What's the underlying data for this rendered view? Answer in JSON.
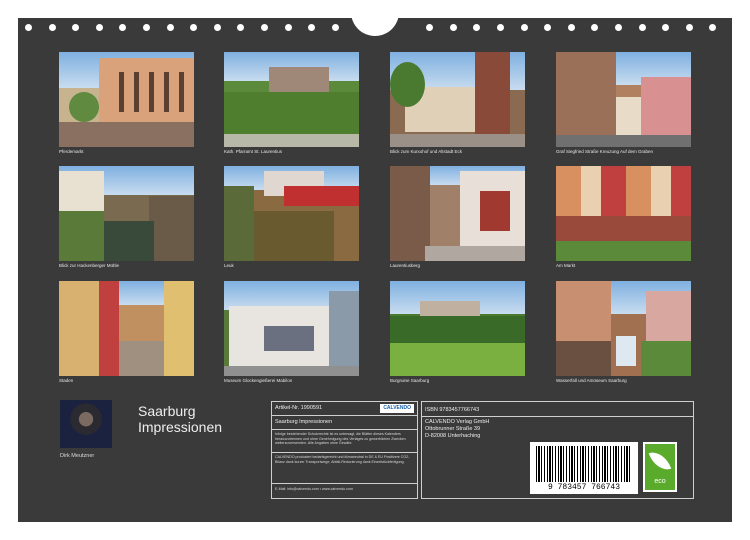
{
  "captions": [
    "Pferdemarkt",
    "Kath. Pfarramt St. Laurentius",
    "Blick zum Kurxohof und Altstadt Eck",
    "Graf Siegfried Straße Kreuzung Auf dem Graben",
    "Blick zur Hackenberger Mühle",
    "Leuk",
    "Laurentiusberg",
    "Am Markt",
    "Staden",
    "Museum Glockengießerei Mabilon",
    "Burgruine Saarburg",
    "Wasserfall und Amüseum Saarburg"
  ],
  "title_line1": "Saarburg",
  "title_line2": "Impressionen",
  "author": "Dirk Meutzner",
  "article_label": "Artikel-Nr. 1990591",
  "calvendo_logo": "CALVENDO",
  "product_title": "Saarburg Impressionen",
  "legal_text": "Infolge bestehender Schutzrechte ist es untersagt, die Blätter dieses Kalenders herauszutrennen und ohne Genehmigung des Verlages zu gewerblichen Zwecken weiterzuverwenden. Alle Angaben ohne Gewähr.",
  "eco_text": "CALVENDO produziert bedarfsgerecht und klimaneutral in DE & EU Positivere CO2-Bilanz dank kurzer Transportwege, Abfall-Reduzierung dank Einzelstückfertigung.",
  "contact": "E-Mail: info@calvendo.com • www.calvendo.com",
  "isbn": "ISBN 9783457766743",
  "publisher": [
    "CALVENDO Verlag GmbH",
    "Ottobrunner Straße 39",
    "D-82008 Unterhaching"
  ],
  "barcode_digits": "9 783457 766743",
  "eco_label": "eco",
  "colors": {
    "sheet": "#3a3a3a",
    "eco_green": "#5aab2c",
    "calvendo_blue": "#1a5fa8"
  }
}
